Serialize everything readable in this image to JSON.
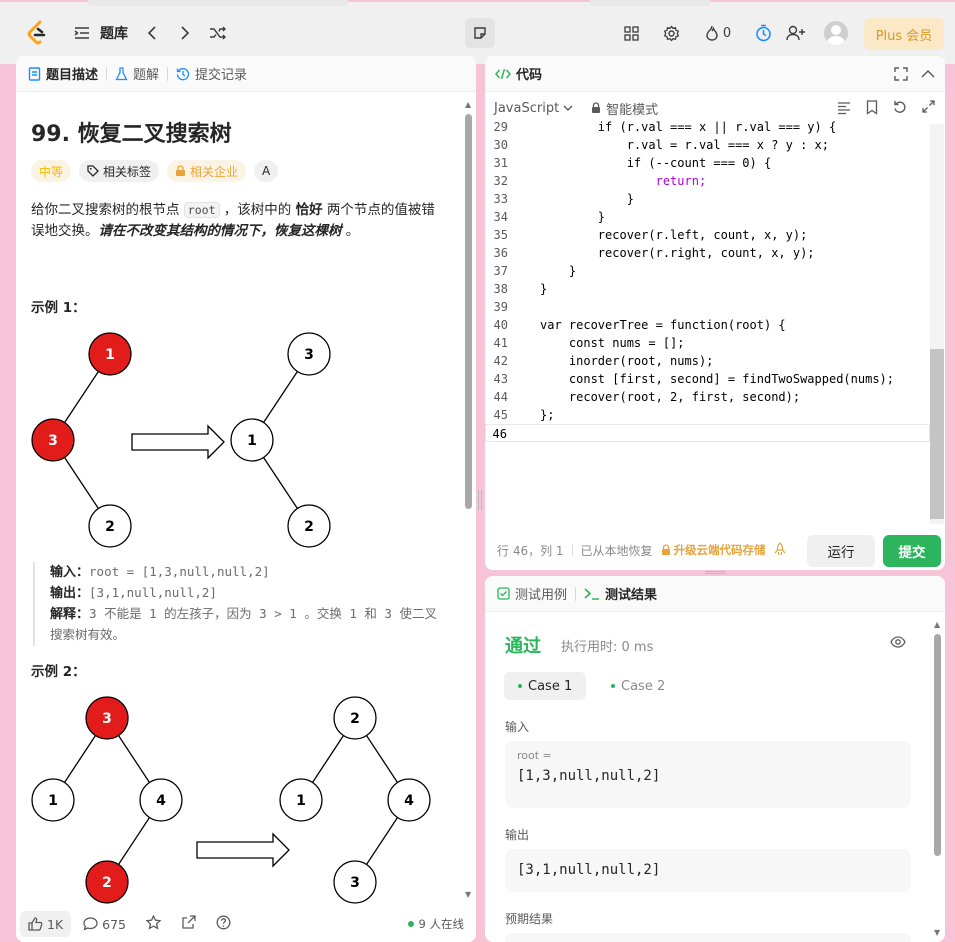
{
  "topbar": {
    "problem_list_label": "题库",
    "streak_count": "0",
    "plus_label": "Plus 会员"
  },
  "left": {
    "tabs": [
      {
        "label": "题目描述"
      },
      {
        "label": "题解"
      },
      {
        "label": "提交记录"
      }
    ],
    "title": "99. 恢复二叉搜索树",
    "tags": {
      "difficulty": "中等",
      "related_tags": "相关标签",
      "related_companies": "相关企业",
      "font_icon": "A"
    },
    "description": {
      "p1_a": "给你二叉搜索树的根节点 ",
      "p1_code": "root",
      "p1_b": " ，该树中的 ",
      "p1_bold": "恰好",
      "p1_c": " 两个节点的值被错误地交换。",
      "p1_italic": "请在不改变其结构的情况下，恢复这棵树",
      "p1_end": " 。"
    },
    "example1": {
      "title": "示例 1：",
      "input_label": "输入：",
      "input_value": "root = [1,3,null,null,2]",
      "output_label": "输出：",
      "output_value": "[3,1,null,null,2]",
      "explain_label": "解释：",
      "explain_value": "3 不能是 1 的左孩子，因为 3 > 1 。交换 1 和 3 使二叉搜索树有效。",
      "before_nodes": [
        "1",
        "3",
        "2"
      ],
      "after_nodes": [
        "3",
        "1",
        "2"
      ]
    },
    "example2": {
      "title": "示例 2：",
      "before_nodes": [
        "3",
        "1",
        "4",
        "2"
      ],
      "after_nodes": [
        "2",
        "1",
        "4",
        "3"
      ]
    },
    "footer": {
      "likes": "1K",
      "comments": "675",
      "online": "9 人在线"
    }
  },
  "code_panel": {
    "title": "代码",
    "language": "JavaScript",
    "mode": "智能模式",
    "lines": [
      {
        "n": "29",
        "code": "        if (r.val === x || r.val === y) {"
      },
      {
        "n": "30",
        "code": "            r.val = r.val === x ? y : x;"
      },
      {
        "n": "31",
        "code": "            if (--count === 0) {"
      },
      {
        "n": "32",
        "code": "                return;"
      },
      {
        "n": "33",
        "code": "            }"
      },
      {
        "n": "34",
        "code": "        }"
      },
      {
        "n": "35",
        "code": "        recover(r.left, count, x, y);"
      },
      {
        "n": "36",
        "code": "        recover(r.right, count, x, y);"
      },
      {
        "n": "37",
        "code": "    }"
      },
      {
        "n": "38",
        "code": "}"
      },
      {
        "n": "39",
        "code": ""
      },
      {
        "n": "40",
        "code": "var recoverTree = function(root) {"
      },
      {
        "n": "41",
        "code": "    const nums = [];"
      },
      {
        "n": "42",
        "code": "    inorder(root, nums);"
      },
      {
        "n": "43",
        "code": "    const [first, second] = findTwoSwapped(nums);"
      },
      {
        "n": "44",
        "code": "    recover(root, 2, first, second);"
      },
      {
        "n": "45",
        "code": "};"
      },
      {
        "n": "46",
        "code": ""
      }
    ],
    "status_position": "行 46，列 1",
    "status_restored": "已从本地恢复",
    "status_upgrade": "升级云端代码存储",
    "run_label": "运行",
    "submit_label": "提交"
  },
  "result_panel": {
    "tab_testcase": "测试用例",
    "tab_result": "测试结果",
    "pass_label": "通过",
    "runtime": "执行用时: 0 ms",
    "cases": [
      "Case 1",
      "Case 2"
    ],
    "input_label": "输入",
    "input_var": "root =",
    "input_value": "[1,3,null,null,2]",
    "output_label": "输出",
    "output_value": "[3,1,null,null,2]",
    "expected_label": "预期结果"
  },
  "colors": {
    "accent_green": "#2db55d",
    "node_red": "#e21b1b",
    "plus_gold": "#d69a26"
  }
}
